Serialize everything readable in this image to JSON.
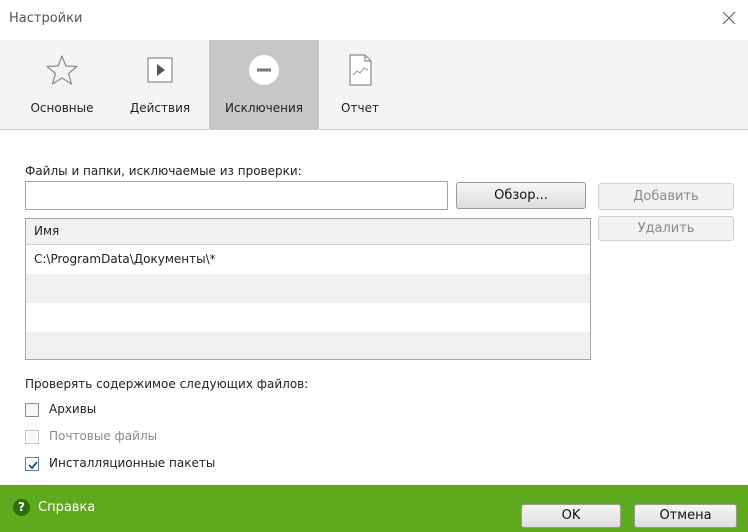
{
  "window": {
    "title": "Настройки",
    "accent_color": "#5daa1f"
  },
  "tabs": [
    {
      "label": "Основные",
      "icon": "star-icon",
      "active": false
    },
    {
      "label": "Действия",
      "icon": "play-icon",
      "active": false
    },
    {
      "label": "Исключения",
      "icon": "minus-circle-icon",
      "active": true
    },
    {
      "label": "Отчет",
      "icon": "report-icon",
      "active": false
    }
  ],
  "exclusions": {
    "section_label": "Файлы и папки, исключаемые из проверки:",
    "path_input_value": "",
    "browse_label": "Обзор...",
    "add_label": "Добавить",
    "remove_label": "Удалить",
    "list_header": "Имя",
    "items": [
      "C:\\ProgramData\\Документы\\*"
    ]
  },
  "scan_contents": {
    "label": "Проверять содержимое следующих файлов:",
    "options": [
      {
        "label": "Архивы",
        "checked": false,
        "enabled": true
      },
      {
        "label": "Почтовые файлы",
        "checked": false,
        "enabled": false
      },
      {
        "label": "Инсталляционные пакеты",
        "checked": true,
        "enabled": true
      }
    ]
  },
  "footer": {
    "help_label": "Справка",
    "ok_label": "OK",
    "cancel_label": "Отмена"
  }
}
